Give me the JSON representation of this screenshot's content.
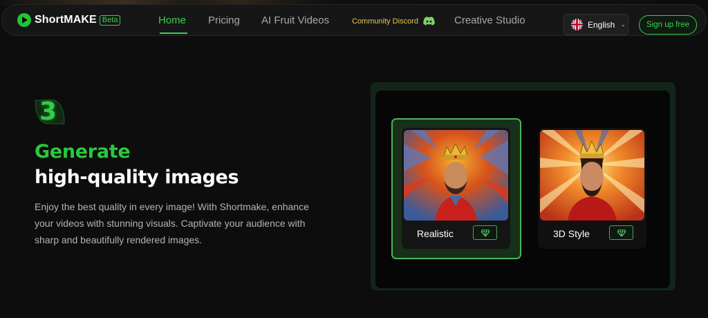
{
  "nav": {
    "logo_text": "ShortMAKE",
    "logo_badge": "Beta",
    "links": [
      {
        "label": "Home",
        "active": true
      },
      {
        "label": "Pricing"
      },
      {
        "label": "AI Fruit Videos"
      },
      {
        "label": "Community Discord",
        "icon": "discord-icon"
      },
      {
        "label": "Creative Studio"
      }
    ],
    "language": {
      "label": "English",
      "icon": "uk-flag-icon"
    },
    "signup_label": "Sign up free"
  },
  "hero": {
    "step_number": "3",
    "headline_green": "Generate",
    "headline_white": "high-quality images",
    "description": "Enjoy the best quality in every image! With Shortmake, enhance your videos with stunning visuals. Captivate your audience with sharp and beautifully rendered images."
  },
  "styles": [
    {
      "label": "Realistic",
      "selected": true,
      "icon": "gem-icon"
    },
    {
      "label": "3D Style",
      "selected": false,
      "icon": "gem-icon"
    }
  ],
  "colors": {
    "accent": "#3ad24f",
    "background": "#0d0d0d",
    "discord_text": "#e2c84a"
  }
}
